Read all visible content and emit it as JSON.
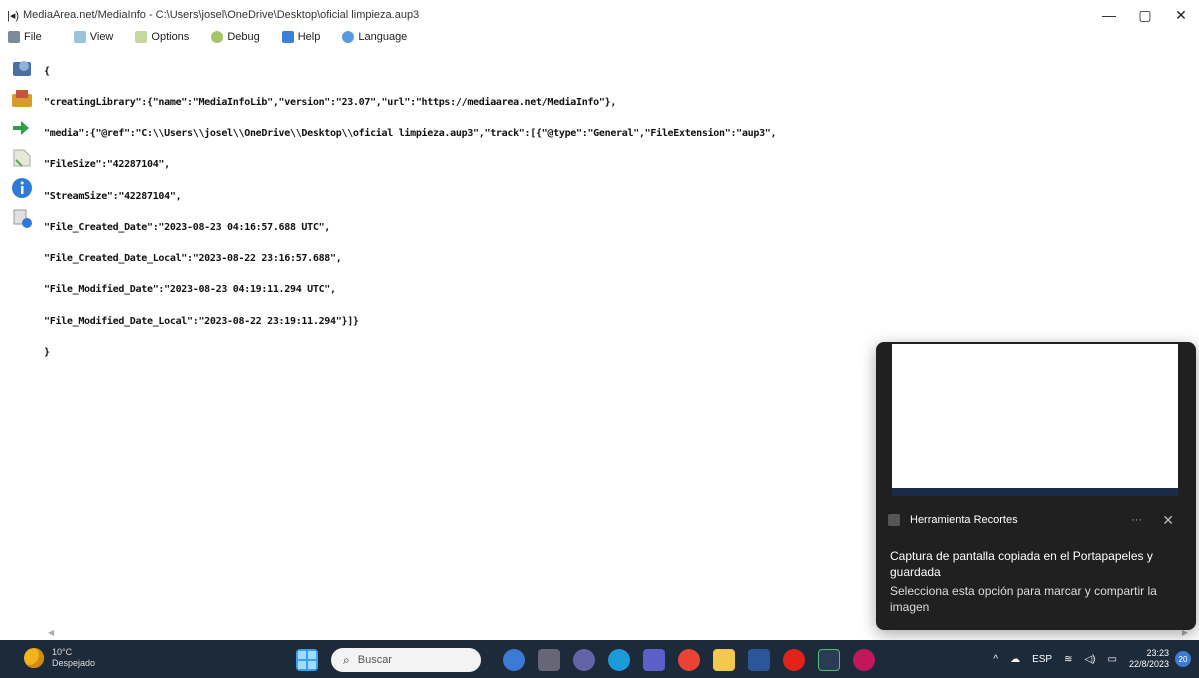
{
  "window": {
    "title": "MediaArea.net/MediaInfo - C:\\Users\\josel\\OneDrive\\Desktop\\oficial limpieza.aup3",
    "app_icon": "mediainfo-icon"
  },
  "menu": {
    "items": [
      {
        "label": "File",
        "icon": "file-icon"
      },
      {
        "label": "View",
        "icon": "view-icon"
      },
      {
        "label": "Options",
        "icon": "options-icon"
      },
      {
        "label": "Debug",
        "icon": "debug-icon"
      },
      {
        "label": "Help",
        "icon": "help-icon"
      },
      {
        "label": "Language",
        "icon": "language-icon"
      }
    ]
  },
  "content": {
    "lines": [
      "{",
      "\"creatingLibrary\":{\"name\":\"MediaInfoLib\",\"version\":\"23.07\",\"url\":\"https://mediaarea.net/MediaInfo\"},",
      "\"media\":{\"@ref\":\"C:\\\\Users\\\\josel\\\\OneDrive\\\\Desktop\\\\oficial limpieza.aup3\",\"track\":[{\"@type\":\"General\",\"FileExtension\":\"aup3\",",
      "\"FileSize\":\"42287104\",",
      "\"StreamSize\":\"42287104\",",
      "\"File_Created_Date\":\"2023-08-23 04:16:57.688 UTC\",",
      "\"File_Created_Date_Local\":\"2023-08-22 23:16:57.688\",",
      "\"File_Modified_Date\":\"2023-08-23 04:19:11.294 UTC\",",
      "\"File_Modified_Date_Local\":\"2023-08-22 23:19:11.294\"}]}",
      "}"
    ]
  },
  "toast": {
    "app_name": "Herramienta Recortes",
    "more": "···",
    "message": "Captura de pantalla copiada en el Portapapeles y guardada",
    "sub_message": "Selecciona esta opción para marcar y compartir la imagen"
  },
  "taskbar": {
    "temp": "10°C",
    "weather": "Despejado",
    "search_placeholder": "Buscar",
    "lang": "ESP",
    "time": "23:23",
    "date": "22/8/2023",
    "notifications": "20"
  },
  "colors": {
    "taskbar_bg": "#1c2a3a",
    "toast_bg": "#202020"
  }
}
